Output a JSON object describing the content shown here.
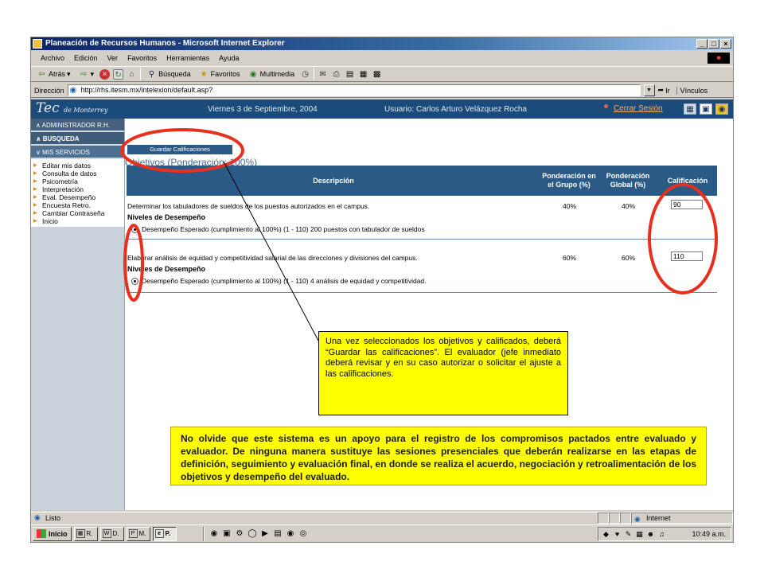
{
  "window": {
    "title": "Planeación de Recursos Humanos - Microsoft Internet Explorer",
    "controls": [
      "_",
      "□",
      "×"
    ]
  },
  "menu": [
    "Archivo",
    "Edición",
    "Ver",
    "Favoritos",
    "Herramientas",
    "Ayuda"
  ],
  "toolbar": {
    "back": "Atrás",
    "search": "Búsqueda",
    "favorites": "Favoritos",
    "media": "Multimedia"
  },
  "address": {
    "label": "Dirección",
    "url": "http://rhs.itesm.mx/intelexion/default.asp?",
    "go": "Ir",
    "links": "Vínculos"
  },
  "header": {
    "logo_main": "Tec",
    "logo_sub": "de Monterrey",
    "date": "Viernes 3 de Septiembre, 2004",
    "user": "Usuario: Carlos Arturo Velázquez Rocha",
    "logout": "Cerrar Sesión"
  },
  "sidebar": {
    "sections": [
      "ADMINISTRADOR R.H.",
      "BUSQUEDA",
      "MIS SERVICIOS"
    ],
    "links": [
      "Editar mis datos",
      "Consulta de datos",
      "Psicometría",
      "Interpretación",
      "Eval. Desempeño",
      "Encuesta Retro.",
      "Cambiar Contraseña",
      "Inicio"
    ]
  },
  "main": {
    "save_button": "Guardar Calificaciones",
    "objectives_title": "Objetivos (Ponderación: 100%)",
    "columns": {
      "description": "Descripción",
      "group_weight": "Ponderación en el Grupo (%)",
      "global_weight": "Ponderación Global (%)",
      "score": "Calificación"
    },
    "levels_heading": "Niveles de Desempeño",
    "rows": [
      {
        "description": "Determinar los tabuladores de sueldos de los puestos autorizados en el campus.",
        "group_weight": "40%",
        "global_weight": "40%",
        "score": "90",
        "level": "Desempeño Esperado (cumplimiento al 100%) (1 - 110) 200 puestos con tabulador de sueldos"
      },
      {
        "description": "Elaborar análisis de equidad y competitividad salarial de las direcciones y divisiones del campus.",
        "group_weight": "60%",
        "global_weight": "60%",
        "score": "110",
        "level": "Desempeño Esperado (cumplimiento al 100%) (1 - 110) 4 análisis de equidad y competitividad."
      }
    ]
  },
  "status": {
    "text": "Listo",
    "zone": "Internet"
  },
  "taskbar": {
    "start": "Inicio",
    "buttons": [
      "R.",
      "D.",
      "M.",
      "P."
    ],
    "clock": "10:49 a.m."
  },
  "annotations": {
    "note": "Una vez seleccionados los objetivos y calificados, deberá “Guardar las calificaciones”. El evaluador (jefe inmediato deberá revisar y en su caso autorizar o solicitar el ajuste a las calificaciones.",
    "warning": "No olvide que este sistema es un apoyo para el registro de los compromisos pactados entre evaluado y evaluador. De ninguna manera sustituye las sesiones presenciales que deberán realizarse en las etapas de definición, seguimiento y evaluación final, en donde se realiza el acuerdo, negociación y retroalimentación de los objetivos y desempeño del evaluado."
  },
  "colors": {
    "header": "#1b4b7b",
    "table_header": "#2c5a86",
    "annotation_red": "#e8301e",
    "note_bg": "#ffff00"
  }
}
